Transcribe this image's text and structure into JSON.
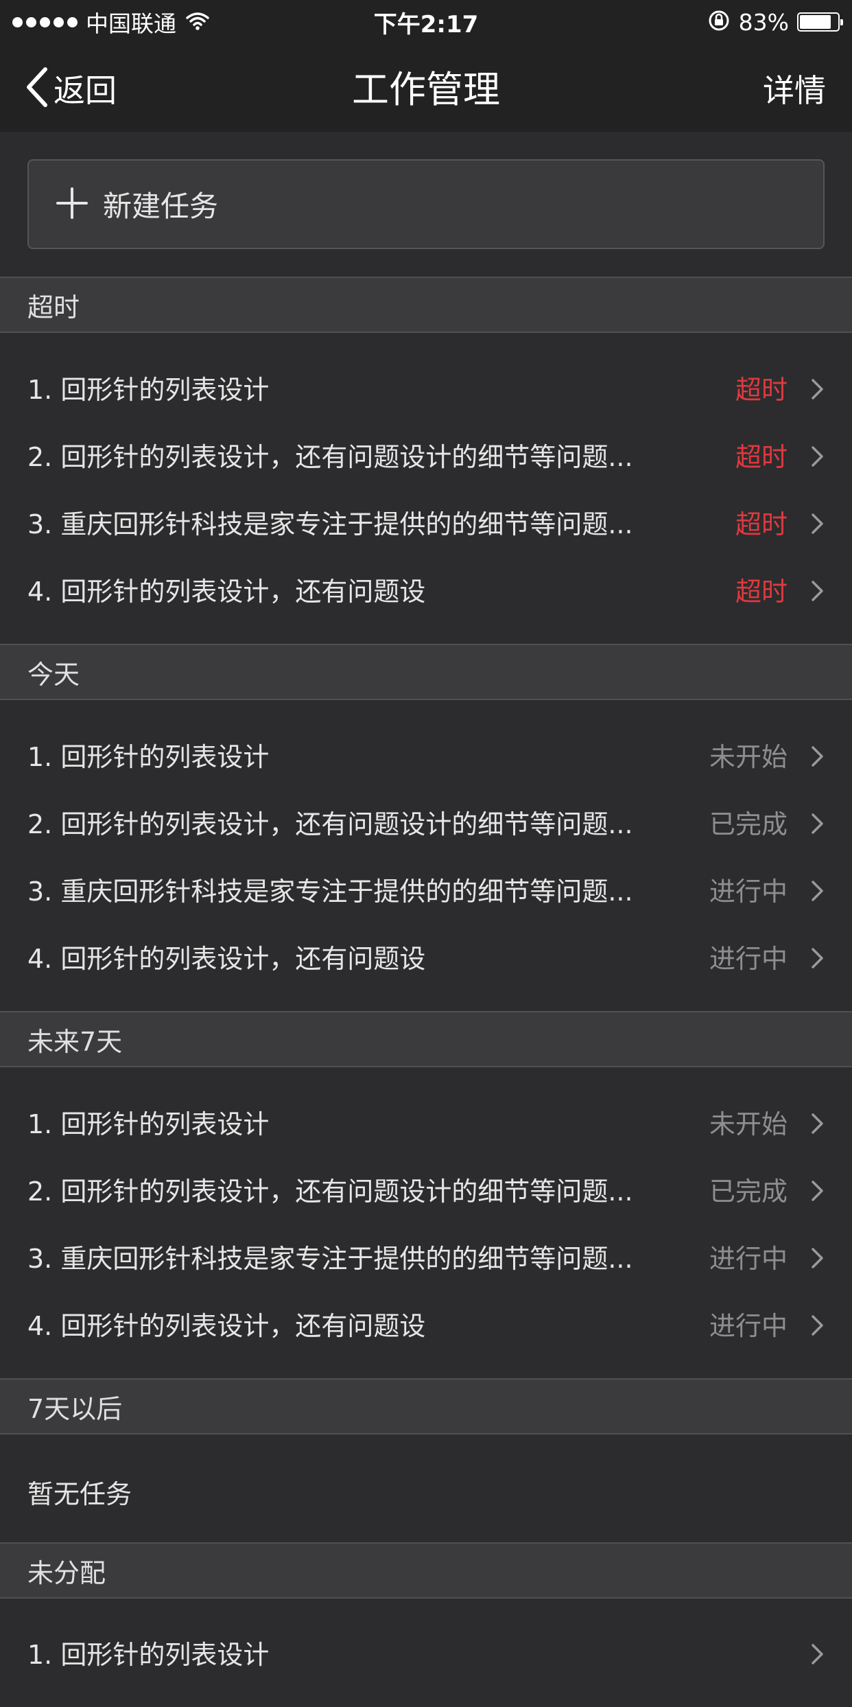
{
  "status_bar": {
    "carrier": "中国联通",
    "time": "下午2:17",
    "battery_percent": "83%",
    "battery_level": 0.83
  },
  "nav": {
    "back_label": "返回",
    "title": "工作管理",
    "detail_label": "详情"
  },
  "new_task": {
    "label": "新建任务"
  },
  "sections": [
    {
      "header": "超时",
      "items": [
        {
          "title": "1. 回形针的列表设计",
          "status": "超时"
        },
        {
          "title": "2. 回形针的列表设计，还有问题设计的细节等问题...",
          "status": "超时"
        },
        {
          "title": "3. 重庆回形针科技是家专注于提供的的细节等问题...",
          "status": "超时"
        },
        {
          "title": "4. 回形针的列表设计，还有问题设",
          "status": "超时"
        }
      ]
    },
    {
      "header": "今天",
      "items": [
        {
          "title": "1. 回形针的列表设计",
          "status": "未开始"
        },
        {
          "title": "2. 回形针的列表设计，还有问题设计的细节等问题...",
          "status": "已完成"
        },
        {
          "title": "3. 重庆回形针科技是家专注于提供的的细节等问题...",
          "status": "进行中"
        },
        {
          "title": "4. 回形针的列表设计，还有问题设",
          "status": "进行中"
        }
      ]
    },
    {
      "header": "未来7天",
      "items": [
        {
          "title": "1. 回形针的列表设计",
          "status": "未开始"
        },
        {
          "title": "2. 回形针的列表设计，还有问题设计的细节等问题...",
          "status": "已完成"
        },
        {
          "title": "3. 重庆回形针科技是家专注于提供的的细节等问题...",
          "status": "进行中"
        },
        {
          "title": "4. 回形针的列表设计，还有问题设",
          "status": "进行中"
        }
      ]
    },
    {
      "header": "7天以后",
      "empty_text": "暂无任务"
    },
    {
      "header": "未分配",
      "items": [
        {
          "title": "1. 回形针的列表设计",
          "status": ""
        }
      ]
    }
  ],
  "colors": {
    "overdue": "#e0393e",
    "muted_status": "#8e8e90",
    "background": "#2c2c2e",
    "header_background": "#3b3b3d"
  },
  "icons": {
    "back": "chevron-left-icon",
    "add": "plus-icon",
    "row": "chevron-right-icon",
    "wifi": "wifi-icon",
    "lock": "rotation-lock-icon"
  }
}
